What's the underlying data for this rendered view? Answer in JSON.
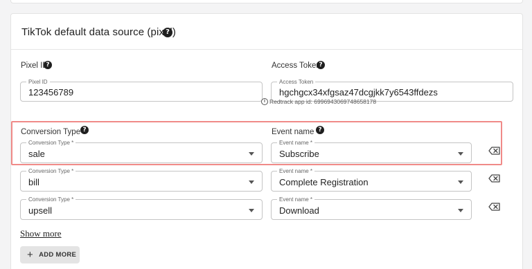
{
  "card": {
    "title": "TikTok default data source (pixel)"
  },
  "pixel": {
    "label": "Pixel ID",
    "legend": "Pixel ID",
    "value": "123456789"
  },
  "token": {
    "label": "Access Token",
    "legend": "Access Token",
    "value": "hgchgcx34xfgsaz47dcgjkk7y6543ffdezs"
  },
  "info_text": "Redtrack app id: 6996943069748658178",
  "conversion_header": {
    "label": "Conversion Type",
    "required_mark": "*"
  },
  "event_header": {
    "label": "Event name",
    "required_mark": "*"
  },
  "rows": [
    {
      "conv_legend": "Conversion Type *",
      "conv_value": "sale",
      "event_legend": "Event name *",
      "event_value": "Subscribe"
    },
    {
      "conv_legend": "Conversion Type *",
      "conv_value": "bill",
      "event_legend": "Event name *",
      "event_value": "Complete Registration"
    },
    {
      "conv_legend": "Conversion Type *",
      "conv_value": "upsell",
      "event_legend": "Event name *",
      "event_value": "Download"
    }
  ],
  "show_more": "Show more",
  "add_more": "ADD MORE",
  "icons": {
    "help": "question-circle-icon",
    "info": "info-circle-icon",
    "delete": "backspace-icon",
    "dropdown": "caret-down-icon",
    "add": "plus-icon"
  },
  "colors": {
    "highlight": "#f08a88",
    "required": "#d32f2f",
    "button_bg": "#e4e4e4"
  }
}
